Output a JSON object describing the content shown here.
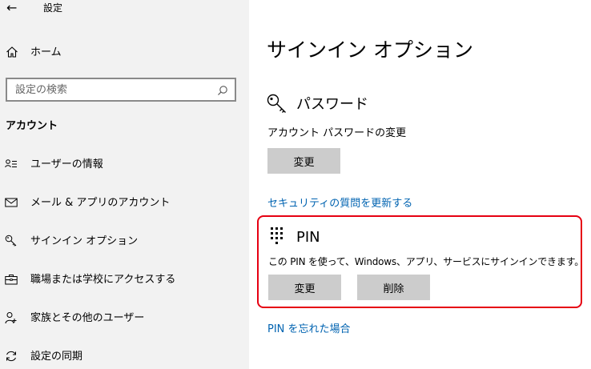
{
  "window": {
    "title": "設定"
  },
  "sidebar": {
    "home_label": "ホーム",
    "search_placeholder": "設定の検索",
    "section_heading": "アカウント",
    "items": [
      {
        "label": "ユーザーの情報",
        "icon": "user-info-icon"
      },
      {
        "label": "メール & アプリのアカウント",
        "icon": "mail-icon"
      },
      {
        "label": "サインイン オプション",
        "icon": "key-icon"
      },
      {
        "label": "職場または学校にアクセスする",
        "icon": "briefcase-icon"
      },
      {
        "label": "家族とその他のユーザー",
        "icon": "people-icon"
      },
      {
        "label": "設定の同期",
        "icon": "sync-icon"
      }
    ]
  },
  "main": {
    "title": "サインイン オプション",
    "password": {
      "heading": "パスワード",
      "description": "アカウント パスワードの変更",
      "change_label": "変更"
    },
    "security_link": "セキュリティの質問を更新する",
    "pin": {
      "heading": "PIN",
      "description": "この PIN を使って、Windows、アプリ、サービスにサインインできます。",
      "change_label": "変更",
      "remove_label": "削除"
    },
    "forgot_pin_link": "PIN を忘れた場合"
  },
  "colors": {
    "sidebar_bg": "#f2f2f2",
    "button_bg": "#cccccc",
    "link": "#0063b1",
    "highlight_border": "#e60012"
  }
}
